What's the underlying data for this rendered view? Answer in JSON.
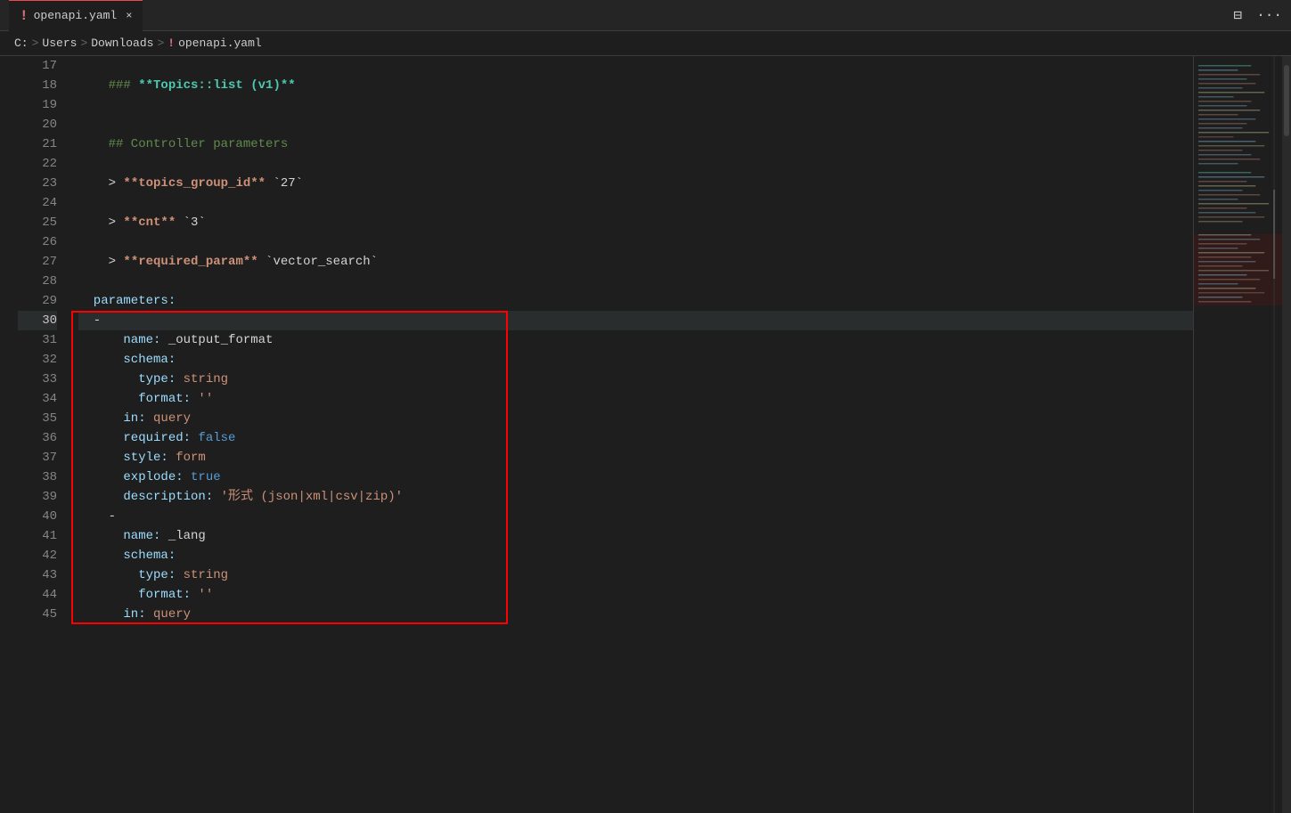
{
  "titleBar": {
    "tabIcon": "!",
    "tabName": "openapi.yaml",
    "tabClose": "×",
    "splitIcon": "⊟",
    "moreIcon": "···"
  },
  "breadcrumb": {
    "drive": "C:",
    "sep1": ">",
    "users": "Users",
    "sep2": ">",
    "downloads": "Downloads",
    "sep3": ">",
    "fileIcon": "!",
    "filename": "openapi.yaml"
  },
  "lines": [
    {
      "num": 17,
      "content": ""
    },
    {
      "num": 18,
      "content": "    ### **Topics::list (v1)**"
    },
    {
      "num": 19,
      "content": ""
    },
    {
      "num": 20,
      "content": ""
    },
    {
      "num": 21,
      "content": "    ## Controller parameters"
    },
    {
      "num": 22,
      "content": ""
    },
    {
      "num": 23,
      "content": "    > **topics_group_id** `27`"
    },
    {
      "num": 24,
      "content": ""
    },
    {
      "num": 25,
      "content": "    > **cnt** `3`"
    },
    {
      "num": 26,
      "content": ""
    },
    {
      "num": 27,
      "content": "    > **required_param** `vector_search`"
    },
    {
      "num": 28,
      "content": ""
    },
    {
      "num": 29,
      "content": "  parameters:"
    },
    {
      "num": 30,
      "content": "  -",
      "active": true
    },
    {
      "num": 31,
      "content": "      name: _output_format"
    },
    {
      "num": 32,
      "content": "      schema:"
    },
    {
      "num": 33,
      "content": "        type: string"
    },
    {
      "num": 34,
      "content": "        format: ''"
    },
    {
      "num": 35,
      "content": "      in: query"
    },
    {
      "num": 36,
      "content": "      required: false"
    },
    {
      "num": 37,
      "content": "      style: form"
    },
    {
      "num": 38,
      "content": "      explode: true"
    },
    {
      "num": 39,
      "content": "      description: '形式 (json|xml|csv|zip)'"
    },
    {
      "num": 40,
      "content": "    -"
    },
    {
      "num": 41,
      "content": "      name: _lang"
    },
    {
      "num": 42,
      "content": "      schema:"
    },
    {
      "num": 43,
      "content": "        type: string"
    },
    {
      "num": 44,
      "content": "        format: ''"
    },
    {
      "num": 45,
      "content": "      in: query"
    }
  ]
}
